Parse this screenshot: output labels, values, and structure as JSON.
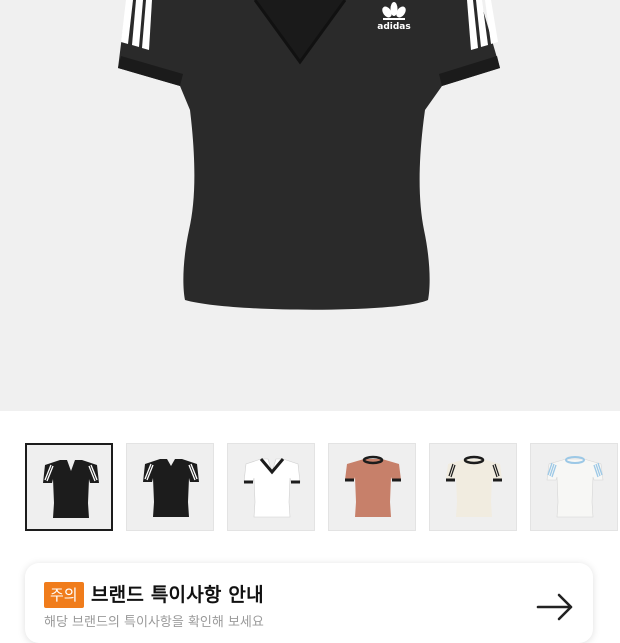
{
  "hero": {
    "image": "black-v-neck-three-stripes-tee",
    "logo_text": "adidas"
  },
  "thumbnails": [
    {
      "name": "black-tee-front",
      "selected": true
    },
    {
      "name": "black-tee-back",
      "selected": false
    },
    {
      "name": "white-tee-black-trim",
      "selected": false
    },
    {
      "name": "clay-tee-black-trim",
      "selected": false
    },
    {
      "name": "cream-tee-black-trim",
      "selected": false
    },
    {
      "name": "white-tee-blue-trim",
      "selected": false
    }
  ],
  "notice": {
    "badge": "주의",
    "title": "브랜드 특이사항 안내",
    "subtitle": "해당 브랜드의 특이사항을 확인해 보세요",
    "arrow_icon": "arrow-right-icon"
  },
  "colors": {
    "badge": "#f07c1b",
    "selected_border": "#1c1c1c",
    "hero_bg": "#f0f0f0"
  }
}
